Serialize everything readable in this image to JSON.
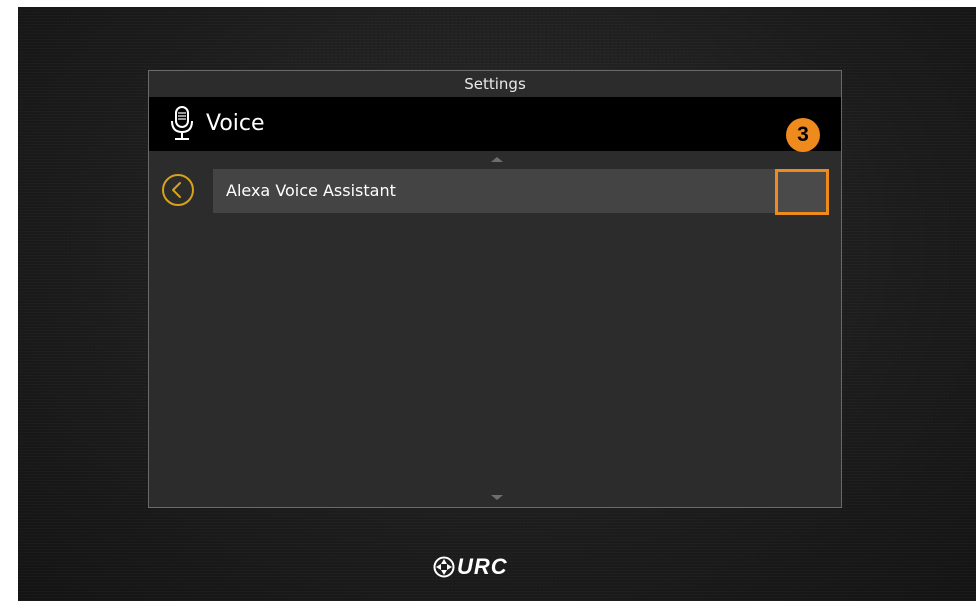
{
  "panel": {
    "title": "Settings"
  },
  "header": {
    "icon": "microphone-icon",
    "title": "Voice"
  },
  "callout": {
    "number": "3",
    "color": "#ef8a1c"
  },
  "list": {
    "items": [
      {
        "label": "Alexa Voice Assistant",
        "toggle_checked": false
      }
    ]
  },
  "icons": {
    "back": "chevron-left-circle-icon",
    "scroll_up": "scroll-up-arrow-icon",
    "scroll_down": "scroll-down-arrow-icon"
  },
  "brand": {
    "logo_text": "URC",
    "accent_color": "#d8a21a"
  }
}
